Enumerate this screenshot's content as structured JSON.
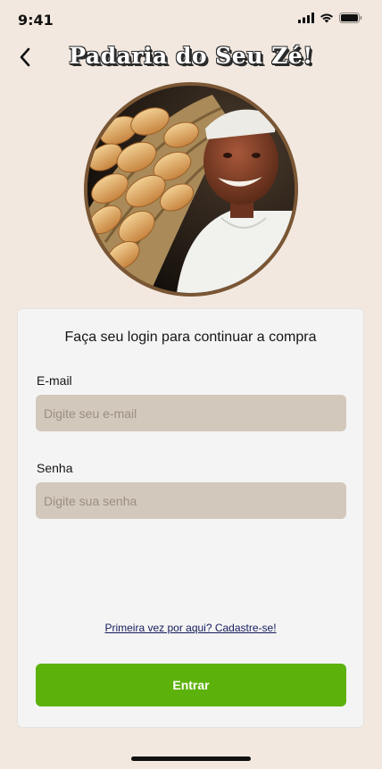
{
  "status_bar": {
    "time": "9:41"
  },
  "header": {
    "title": "Padaria do Seu Zé!"
  },
  "login": {
    "heading": "Faça seu login para continuar a compra",
    "email_label": "E-mail",
    "email_placeholder": "Digite seu e-mail",
    "email_value": "",
    "password_label": "Senha",
    "password_placeholder": "Digite sua senha",
    "password_value": "",
    "signup_link": "Primeira vez por aqui? Cadastre-se!",
    "submit_label": "Entrar"
  },
  "colors": {
    "background": "#f2e8df",
    "primary_button": "#5cb20a",
    "input_fill": "#d3c8bc",
    "link": "#141b5c",
    "photo_border": "#7a5634"
  },
  "icons": {
    "back": "chevron-left-icon",
    "signal": "cellular-signal-icon",
    "wifi": "wifi-icon",
    "battery": "battery-icon"
  }
}
